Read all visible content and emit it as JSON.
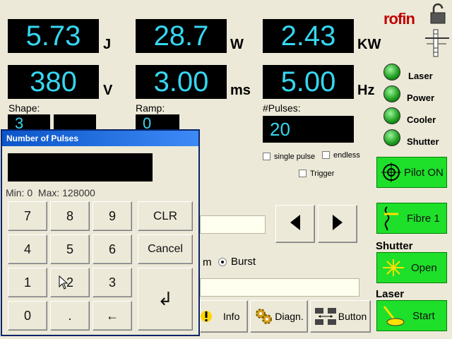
{
  "brand": "rofin",
  "readouts": [
    {
      "value": "5.73",
      "unit": "J"
    },
    {
      "value": "28.7",
      "unit": "W"
    },
    {
      "value": "2.43",
      "unit": "KW"
    },
    {
      "value": "380",
      "unit": "V"
    },
    {
      "value": "3.00",
      "unit": "ms"
    },
    {
      "value": "5.00",
      "unit": "Hz"
    }
  ],
  "params": {
    "shape_label": "Shape:",
    "shape_value": "3",
    "ramp_label": "Ramp:",
    "ramp_value": "0",
    "pulses_label": "#Pulses:",
    "pulses_value": "20"
  },
  "options": {
    "single_pulse": "single pulse",
    "endless": "endless",
    "trigger": "Trigger"
  },
  "status_lights": [
    {
      "label": "Laser",
      "color": "#1ee02a"
    },
    {
      "label": "Power",
      "color": "#1ee02a"
    },
    {
      "label": "Cooler",
      "color": "#1ee02a"
    },
    {
      "label": "Shutter",
      "color": "#1ee02a"
    }
  ],
  "mode": {
    "partial_label": "m",
    "burst_label": "Burst"
  },
  "buttons": {
    "pilot": "Pilot ON",
    "fibre": "Fibre 1",
    "shutter_section": "Shutter",
    "shutter_open": "Open",
    "laser_section": "Laser",
    "laser_start": "Start",
    "info": "Info",
    "diagn": "Diagn.",
    "button": "Button"
  },
  "dialog": {
    "title": "Number of Pulses",
    "range_text": "Min: 0  Max: 128000",
    "keys": [
      "7",
      "8",
      "9",
      "4",
      "5",
      "6",
      "1",
      "2",
      "3",
      "0",
      ".",
      "←"
    ],
    "clr": "CLR",
    "cancel": "Cancel",
    "enter": "↲"
  }
}
